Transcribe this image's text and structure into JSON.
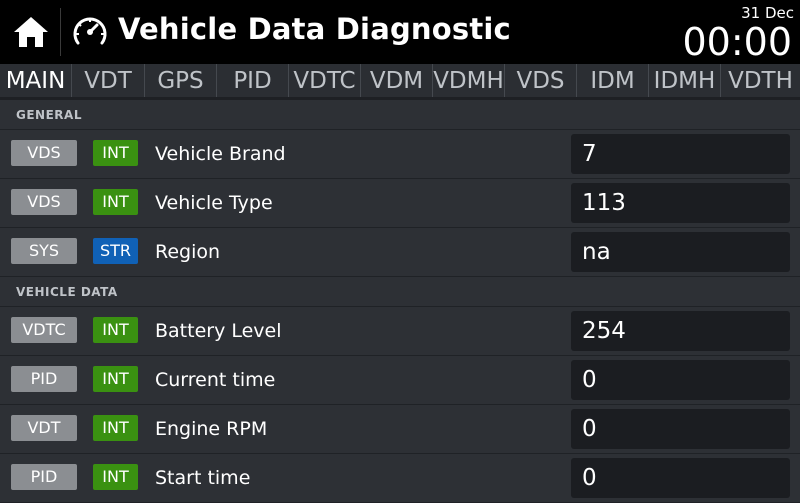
{
  "header": {
    "title": "Vehicle Data Diagnostic",
    "date": "31 Dec",
    "time": "00:00",
    "home_icon": "home-icon",
    "gauge_icon": "gauge-icon"
  },
  "tabs": [
    {
      "label": "MAIN",
      "active": true
    },
    {
      "label": "VDT",
      "active": false
    },
    {
      "label": "GPS",
      "active": false
    },
    {
      "label": "PID",
      "active": false
    },
    {
      "label": "VDTC",
      "active": false
    },
    {
      "label": "VDM",
      "active": false
    },
    {
      "label": "VDMH",
      "active": false
    },
    {
      "label": "VDS",
      "active": false
    },
    {
      "label": "IDM",
      "active": false
    },
    {
      "label": "IDMH",
      "active": false
    },
    {
      "label": "VDTH",
      "active": false
    }
  ],
  "sections": [
    {
      "title": "GENERAL",
      "rows": [
        {
          "source": "VDS",
          "type": "INT",
          "label": "Vehicle Brand",
          "value": "7"
        },
        {
          "source": "VDS",
          "type": "INT",
          "label": "Vehicle Type",
          "value": "113"
        },
        {
          "source": "SYS",
          "type": "STR",
          "label": "Region",
          "value": "na"
        }
      ]
    },
    {
      "title": "VEHICLE DATA",
      "rows": [
        {
          "source": "VDTC",
          "type": "INT",
          "label": "Battery Level",
          "value": "254"
        },
        {
          "source": "PID",
          "type": "INT",
          "label": "Current time",
          "value": "0"
        },
        {
          "source": "VDT",
          "type": "INT",
          "label": "Engine RPM",
          "value": "0"
        },
        {
          "source": "PID",
          "type": "INT",
          "label": "Start time",
          "value": "0"
        }
      ]
    }
  ],
  "colors": {
    "background": "#2d3035",
    "header": "#000000",
    "source_badge": "#8b8e92",
    "int_badge": "#3a9111",
    "str_badge": "#1061b6",
    "value_box": "#1b1d21",
    "active_tab_underline": "#4a90d9"
  }
}
